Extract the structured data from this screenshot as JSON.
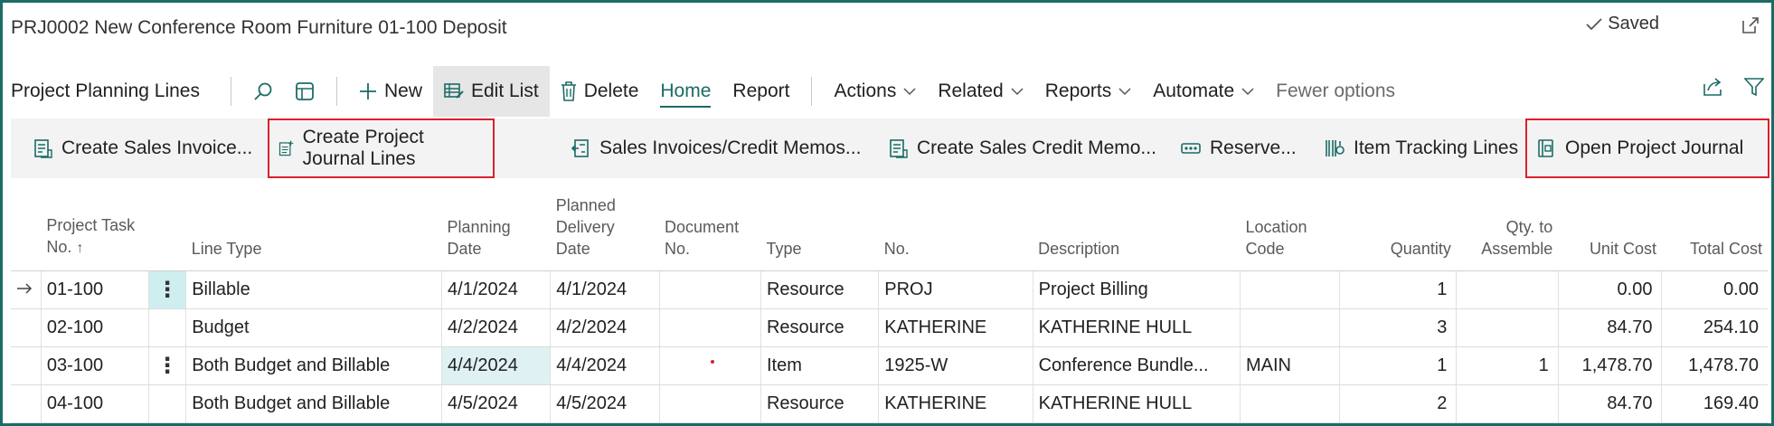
{
  "window": {
    "title": "PRJ0002 New Conference Room Furniture 01-100 Deposit",
    "saved_label": "Saved"
  },
  "actionbar": {
    "page_name": "Project Planning Lines",
    "new_label": "New",
    "edit_list_label": "Edit List",
    "delete_label": "Delete",
    "home_label": "Home",
    "report_label": "Report",
    "actions_label": "Actions",
    "related_label": "Related",
    "reports_label": "Reports",
    "automate_label": "Automate",
    "fewer_options_label": "Fewer options"
  },
  "ribbon": {
    "create_sales_invoice": "Create Sales Invoice...",
    "create_project_journal_lines": "Create Project Journal Lines",
    "sales_invoices_credit_memos": "Sales Invoices/Credit Memos...",
    "create_sales_credit_memo": "Create Sales Credit Memo...",
    "reserve": "Reserve...",
    "item_tracking_lines": "Item Tracking Lines",
    "open_project_journal": "Open Project Journal"
  },
  "table": {
    "headers": {
      "project_task_no_1": "Project Task",
      "project_task_no_2": "No.",
      "project_task_sort": "↑",
      "line_type": "Line Type",
      "planning_date_1": "Planning",
      "planning_date_2": "Date",
      "planned_delivery_1": "Planned",
      "planned_delivery_2": "Delivery",
      "planned_delivery_3": "Date",
      "document_no_1": "Document",
      "document_no_2": "No.",
      "type": "Type",
      "no": "No.",
      "description": "Description",
      "location_code_1": "Location",
      "location_code_2": "Code",
      "quantity": "Quantity",
      "qty_to_assemble_1": "Qty. to",
      "qty_to_assemble_2": "Assemble",
      "unit_cost": "Unit Cost",
      "total_cost": "Total Cost"
    },
    "rows": [
      {
        "task": "01-100",
        "line_type": "Billable",
        "planning_date": "4/1/2024",
        "delivery_date": "4/1/2024",
        "document_no": "",
        "type": "Resource",
        "no": "PROJ",
        "description": "Project Billing",
        "location": "",
        "quantity": "1",
        "qty_assemble": "",
        "unit_cost": "0.00",
        "total_cost": "0.00"
      },
      {
        "task": "02-100",
        "line_type": "Budget",
        "planning_date": "4/2/2024",
        "delivery_date": "4/2/2024",
        "document_no": "",
        "type": "Resource",
        "no": "KATHERINE",
        "description": "KATHERINE HULL",
        "location": "",
        "quantity": "3",
        "qty_assemble": "",
        "unit_cost": "84.70",
        "total_cost": "254.10"
      },
      {
        "task": "03-100",
        "line_type": "Both Budget and Billable",
        "planning_date": "4/4/2024",
        "delivery_date": "4/4/2024",
        "document_no": "",
        "type": "Item",
        "no": "1925-W",
        "description": "Conference Bundle...",
        "location": "MAIN",
        "quantity": "1",
        "qty_assemble": "1",
        "unit_cost": "1,478.70",
        "total_cost": "1,478.70"
      },
      {
        "task": "04-100",
        "line_type": "Both Budget and Billable",
        "planning_date": "4/5/2024",
        "delivery_date": "4/5/2024",
        "document_no": "",
        "type": "Resource",
        "no": "KATHERINE",
        "description": "KATHERINE HULL",
        "location": "",
        "quantity": "2",
        "qty_assemble": "",
        "unit_cost": "84.70",
        "total_cost": "169.40"
      }
    ]
  },
  "colors": {
    "accent": "#1b6b67",
    "highlight_border": "#d9212a",
    "ribbon_bg": "#f3f3f3",
    "selected_cell": "#dff1f3"
  }
}
